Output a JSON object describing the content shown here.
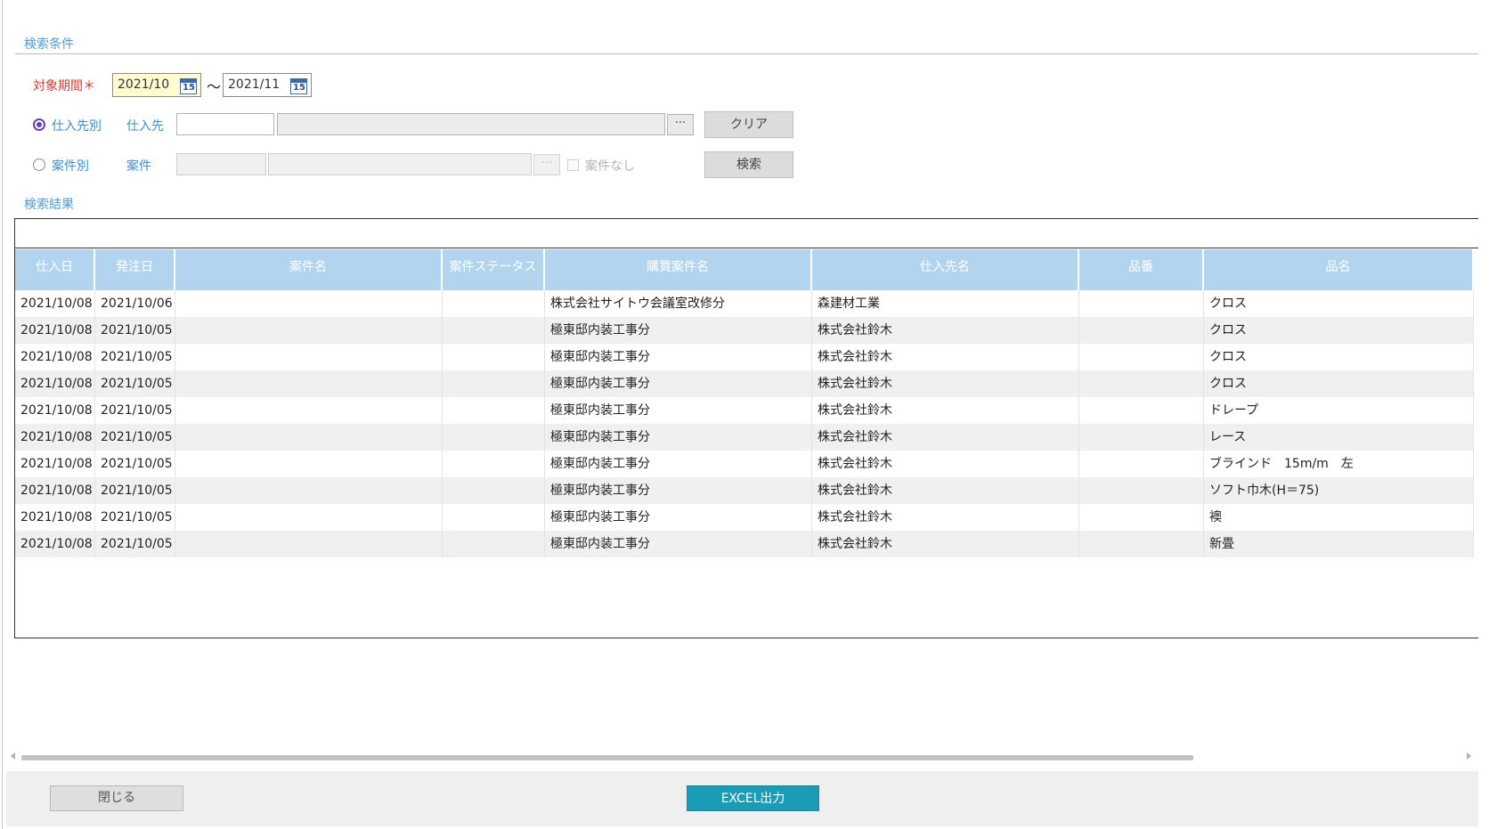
{
  "search_conditions": {
    "section_label": "検索条件",
    "period_label": "対象期間＊",
    "date_from": "2021/10",
    "date_to": "2021/11",
    "range_separator": "～",
    "calendar_icon_text": "15",
    "mode_supplier_label": "仕入先別",
    "supplier_field_label": "仕入先",
    "supplier_code": "",
    "supplier_name": "",
    "ellipsis_label": "···",
    "clear_button": "クリア",
    "mode_project_label": "案件別",
    "project_field_label": "案件",
    "project_code": "",
    "project_name": "",
    "no_project_label": "案件なし",
    "search_button": "検索"
  },
  "results": {
    "section_label": "検索結果",
    "columns": [
      "仕入日",
      "発注日",
      "案件名",
      "案件ステータス",
      "購買案件名",
      "仕入先名",
      "品番",
      "品名"
    ],
    "rows": [
      [
        "2021/10/08",
        "2021/10/06",
        "",
        "",
        "株式会社サイトウ会議室改修分",
        "森建材工業",
        "",
        "クロス"
      ],
      [
        "2021/10/08",
        "2021/10/05",
        "",
        "",
        "極東邸内装工事分",
        "株式会社鈴木",
        "",
        "クロス"
      ],
      [
        "2021/10/08",
        "2021/10/05",
        "",
        "",
        "極東邸内装工事分",
        "株式会社鈴木",
        "",
        "クロス"
      ],
      [
        "2021/10/08",
        "2021/10/05",
        "",
        "",
        "極東邸内装工事分",
        "株式会社鈴木",
        "",
        "クロス"
      ],
      [
        "2021/10/08",
        "2021/10/05",
        "",
        "",
        "極東邸内装工事分",
        "株式会社鈴木",
        "",
        "ドレープ"
      ],
      [
        "2021/10/08",
        "2021/10/05",
        "",
        "",
        "極東邸内装工事分",
        "株式会社鈴木",
        "",
        "レース"
      ],
      [
        "2021/10/08",
        "2021/10/05",
        "",
        "",
        "極東邸内装工事分",
        "株式会社鈴木",
        "",
        "ブラインド　15m/m　左"
      ],
      [
        "2021/10/08",
        "2021/10/05",
        "",
        "",
        "極東邸内装工事分",
        "株式会社鈴木",
        "",
        "ソフト巾木(H＝75)"
      ],
      [
        "2021/10/08",
        "2021/10/05",
        "",
        "",
        "極東邸内装工事分",
        "株式会社鈴木",
        "",
        "襖"
      ],
      [
        "2021/10/08",
        "2021/10/05",
        "",
        "",
        "極東邸内装工事分",
        "株式会社鈴木",
        "",
        "新畳"
      ]
    ]
  },
  "footer": {
    "close_button": "閉じる",
    "excel_button": "EXCEL出力"
  },
  "colors": {
    "accent": "#1c9bb5",
    "header_bg": "#b2d4ee",
    "required": "#d8382f",
    "label_blue": "#3d8ec9",
    "radio": "#6b3fb6"
  }
}
